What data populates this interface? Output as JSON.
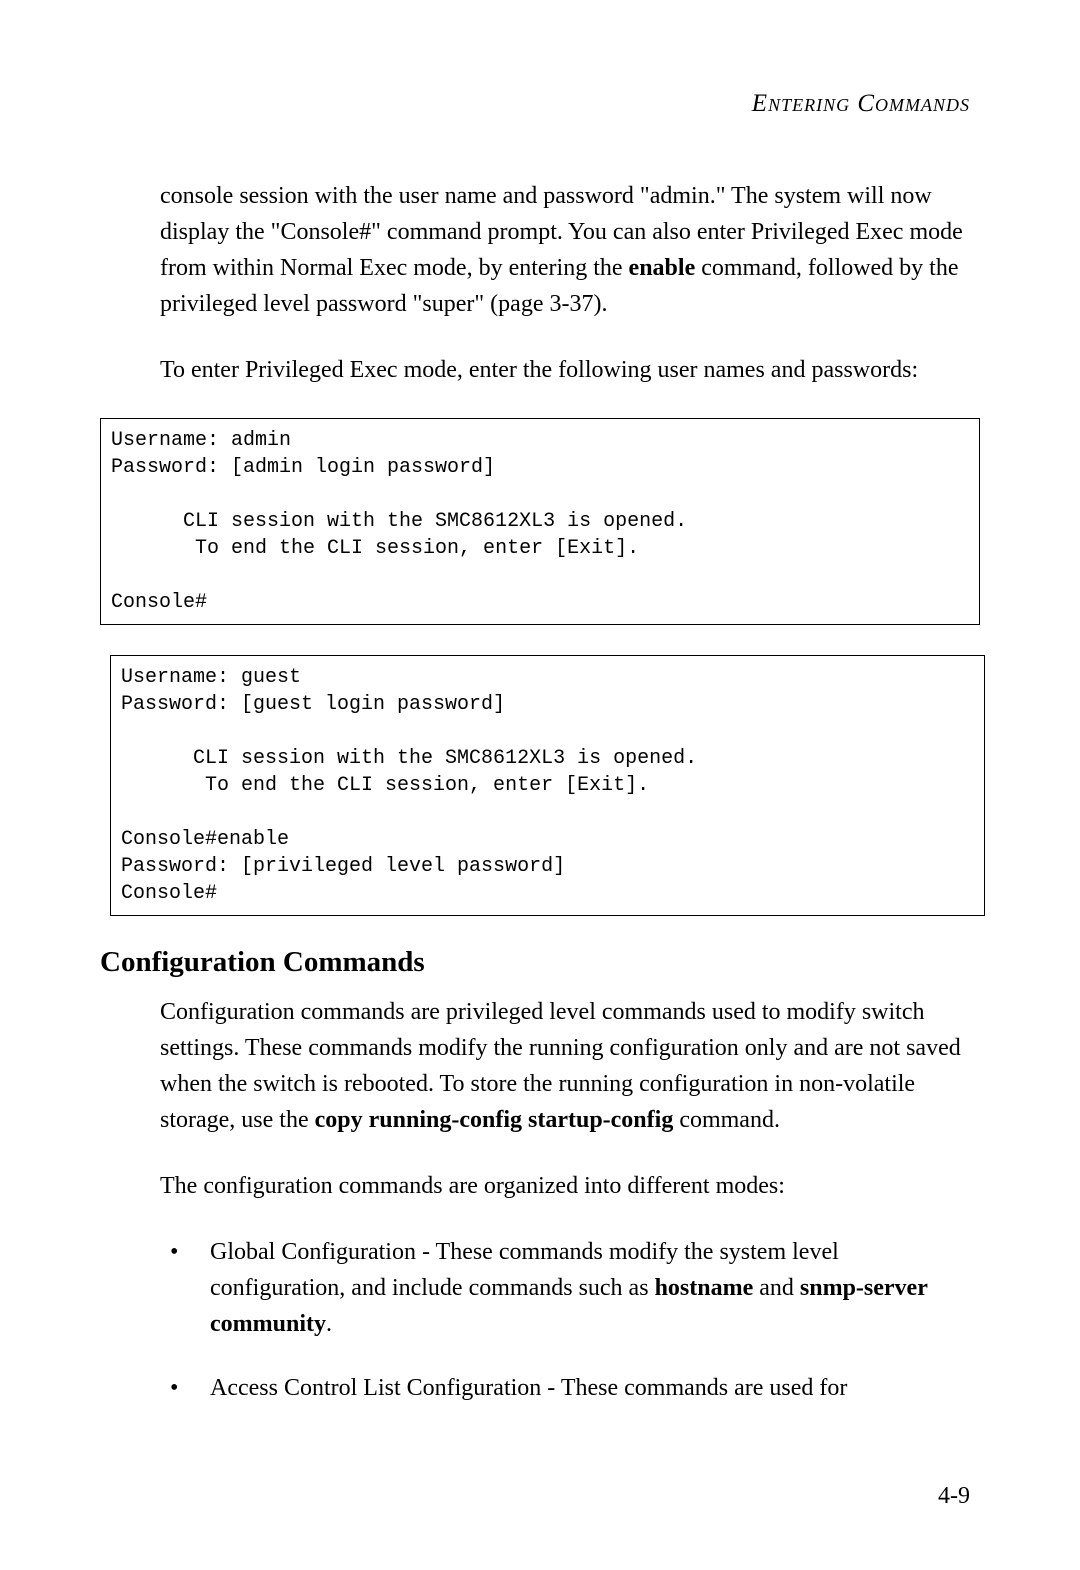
{
  "header": {
    "title": "Entering Commands"
  },
  "paragraphs": {
    "p1_before_bold": "console session with the user name and password \"admin.\" The system will now display the \"Console#\" command prompt. You can also enter Privileged Exec mode from within Normal Exec mode, by entering the ",
    "p1_bold": "enable",
    "p1_after_bold": " command, followed by the privileged level password \"super\" (page 3-37).",
    "p2": "To enter Privileged Exec mode, enter the following user names and passwords:",
    "p3_before_bold": "Configuration commands are privileged level commands used to modify switch settings. These commands modify the running configuration only and are not saved when the switch is rebooted. To store the running configuration in non-volatile storage, use the ",
    "p3_bold": "copy running-config startup-config",
    "p3_after_bold": " command.",
    "p4": "The configuration commands are organized into different modes:"
  },
  "code_blocks": {
    "block1": "Username: admin\nPassword: [admin login password]\n\n      CLI session with the SMC8612XL3 is opened.\n       To end the CLI session, enter [Exit].\n\nConsole#",
    "block2": "Username: guest\nPassword: [guest login password]\n\n      CLI session with the SMC8612XL3 is opened.\n       To end the CLI session, enter [Exit].\n\nConsole#enable\nPassword: [privileged level password]\nConsole#"
  },
  "section": {
    "heading": "Configuration Commands"
  },
  "bullets": {
    "b1_before_bold1": "Global Configuration - These commands modify the system level configuration, and include commands such as ",
    "b1_bold1": "hostname",
    "b1_middle": " and ",
    "b1_bold2": "snmp-server community",
    "b1_after": ".",
    "b2": "Access Control List Configuration - These commands are used for"
  },
  "page_number": "4-9"
}
